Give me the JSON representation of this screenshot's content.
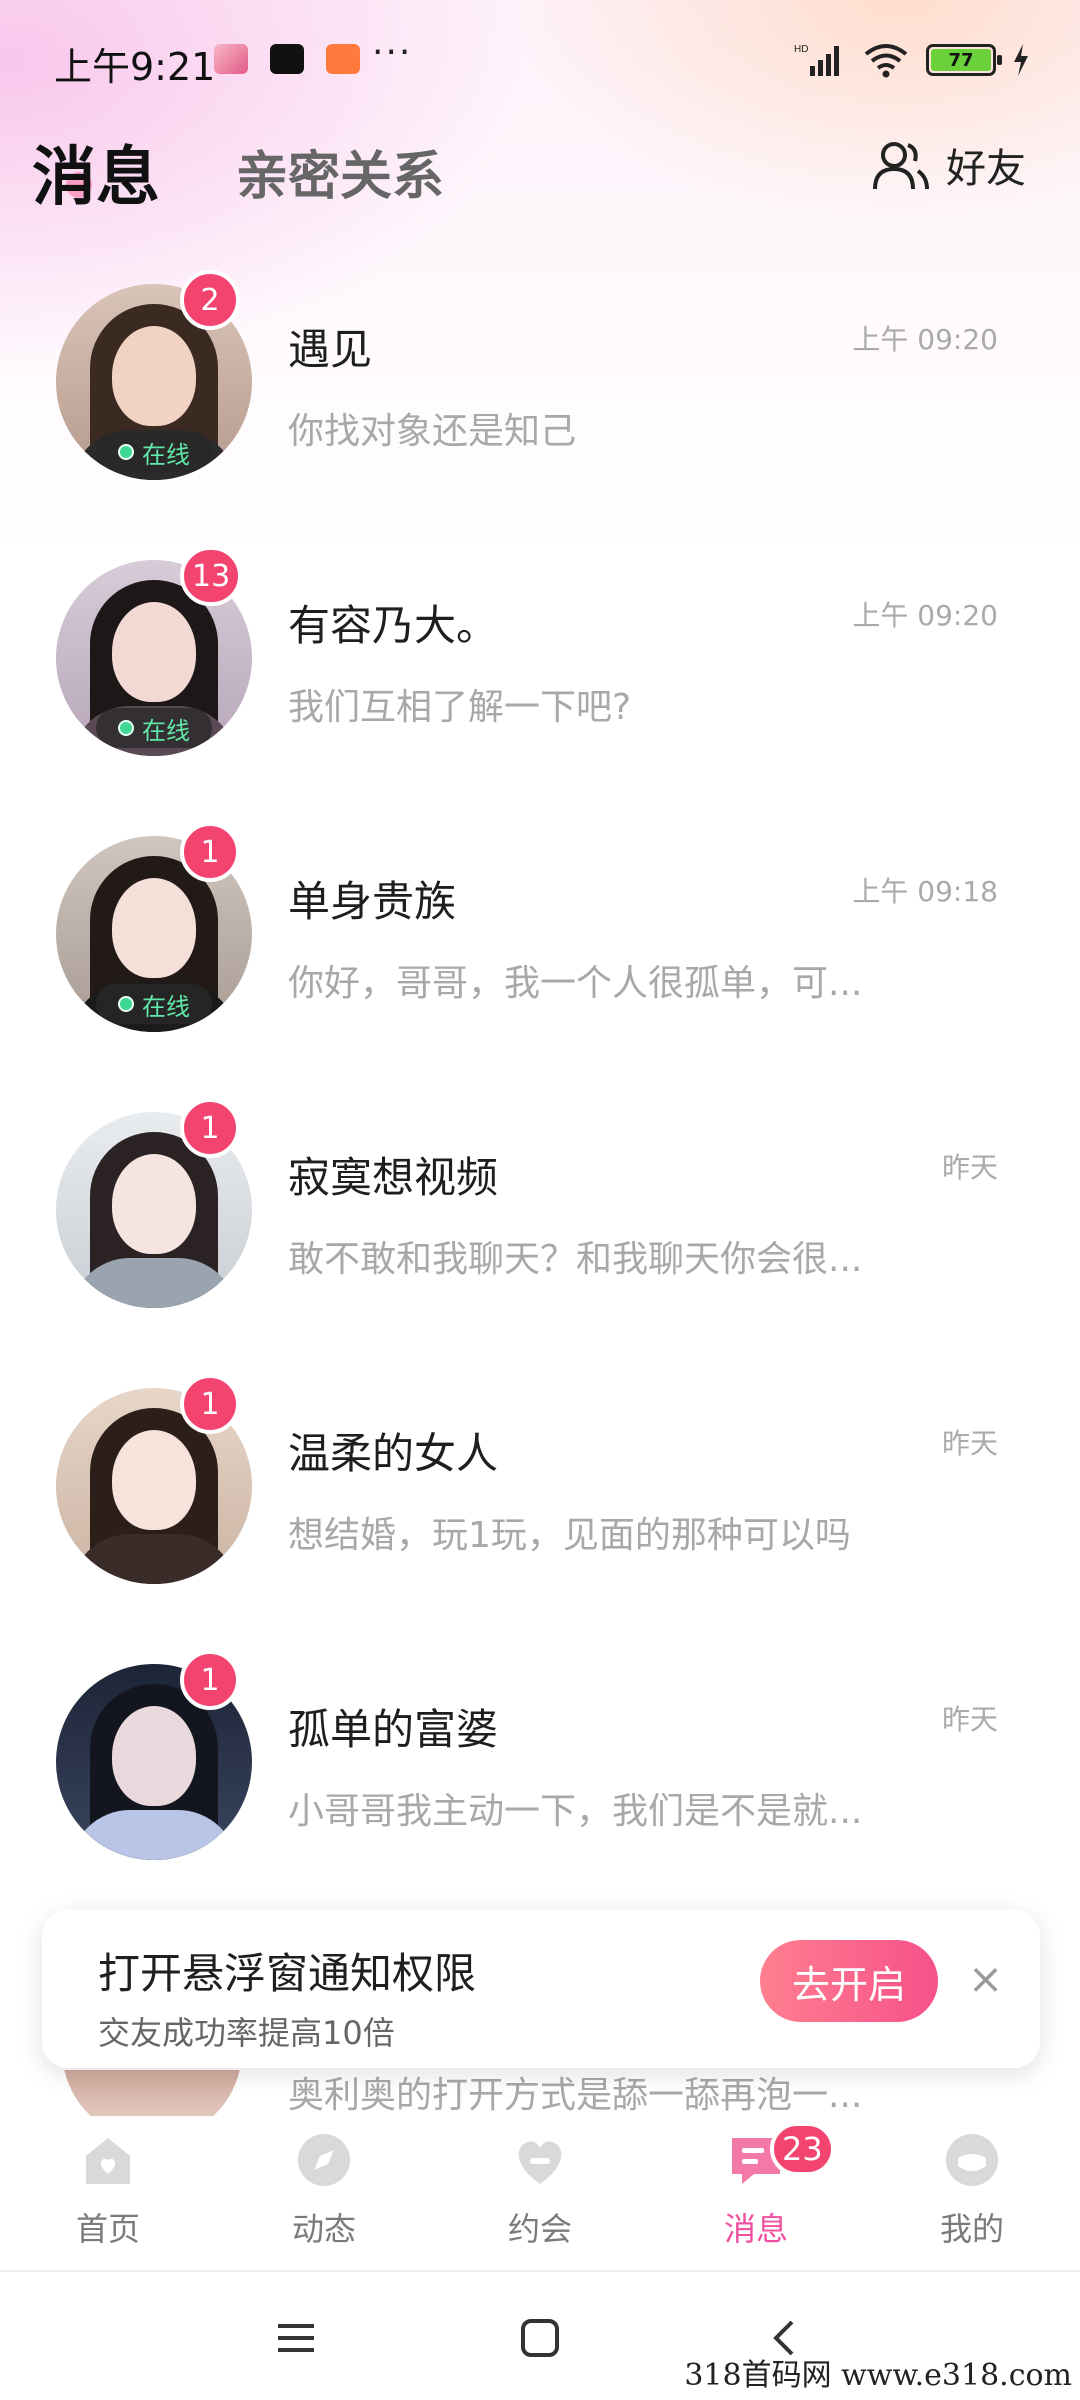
{
  "status_bar": {
    "time": "上午9:21",
    "more": "···",
    "battery": "77"
  },
  "header": {
    "tab_messages": "消息",
    "tab_intimate": "亲密关系",
    "friends_label": "好友"
  },
  "online_label": "在线",
  "conversations": [
    {
      "name": "遇见",
      "preview": "你找对象还是知己",
      "time": "上午 09:20",
      "badge": "2",
      "online": true
    },
    {
      "name": "有容乃大。",
      "preview": "我们互相了解一下吧?",
      "time": "上午 09:20",
      "badge": "13",
      "online": true
    },
    {
      "name": "单身贵族",
      "preview": "你好，哥哥，我一个人很孤单，可...",
      "time": "上午 09:18",
      "badge": "1",
      "online": true
    },
    {
      "name": "寂寞想视频",
      "preview": "敢不敢和我聊天？和我聊天你会很...",
      "time": "昨天",
      "badge": "1",
      "online": false
    },
    {
      "name": "温柔的女人",
      "preview": "想结婚，玩1玩，见面的那种可以吗",
      "time": "昨天",
      "badge": "1",
      "online": false
    },
    {
      "name": "孤单的富婆",
      "preview": "小哥哥我主动一下，我们是不是就...",
      "time": "昨天",
      "badge": "1",
      "online": false
    }
  ],
  "partial_row": {
    "preview": "奥利奥的打开方式是舔一舔再泡一..."
  },
  "permission_card": {
    "title": "打开悬浮窗通知权限",
    "subtitle": "交友成功率提高10倍",
    "button": "去开启",
    "close": "×"
  },
  "bottom_nav": {
    "items": [
      {
        "label": "首页",
        "icon": "home-icon"
      },
      {
        "label": "动态",
        "icon": "compass-icon"
      },
      {
        "label": "约会",
        "icon": "heart-icon"
      },
      {
        "label": "消息",
        "icon": "message-icon",
        "badge": "23",
        "active": true
      },
      {
        "label": "我的",
        "icon": "profile-icon"
      }
    ]
  },
  "watermark": "318首码网  www.e318.com",
  "colors": {
    "accent_pink": "#f04fa0",
    "badge_red": "#f2446f",
    "online_green": "#3fd892"
  }
}
